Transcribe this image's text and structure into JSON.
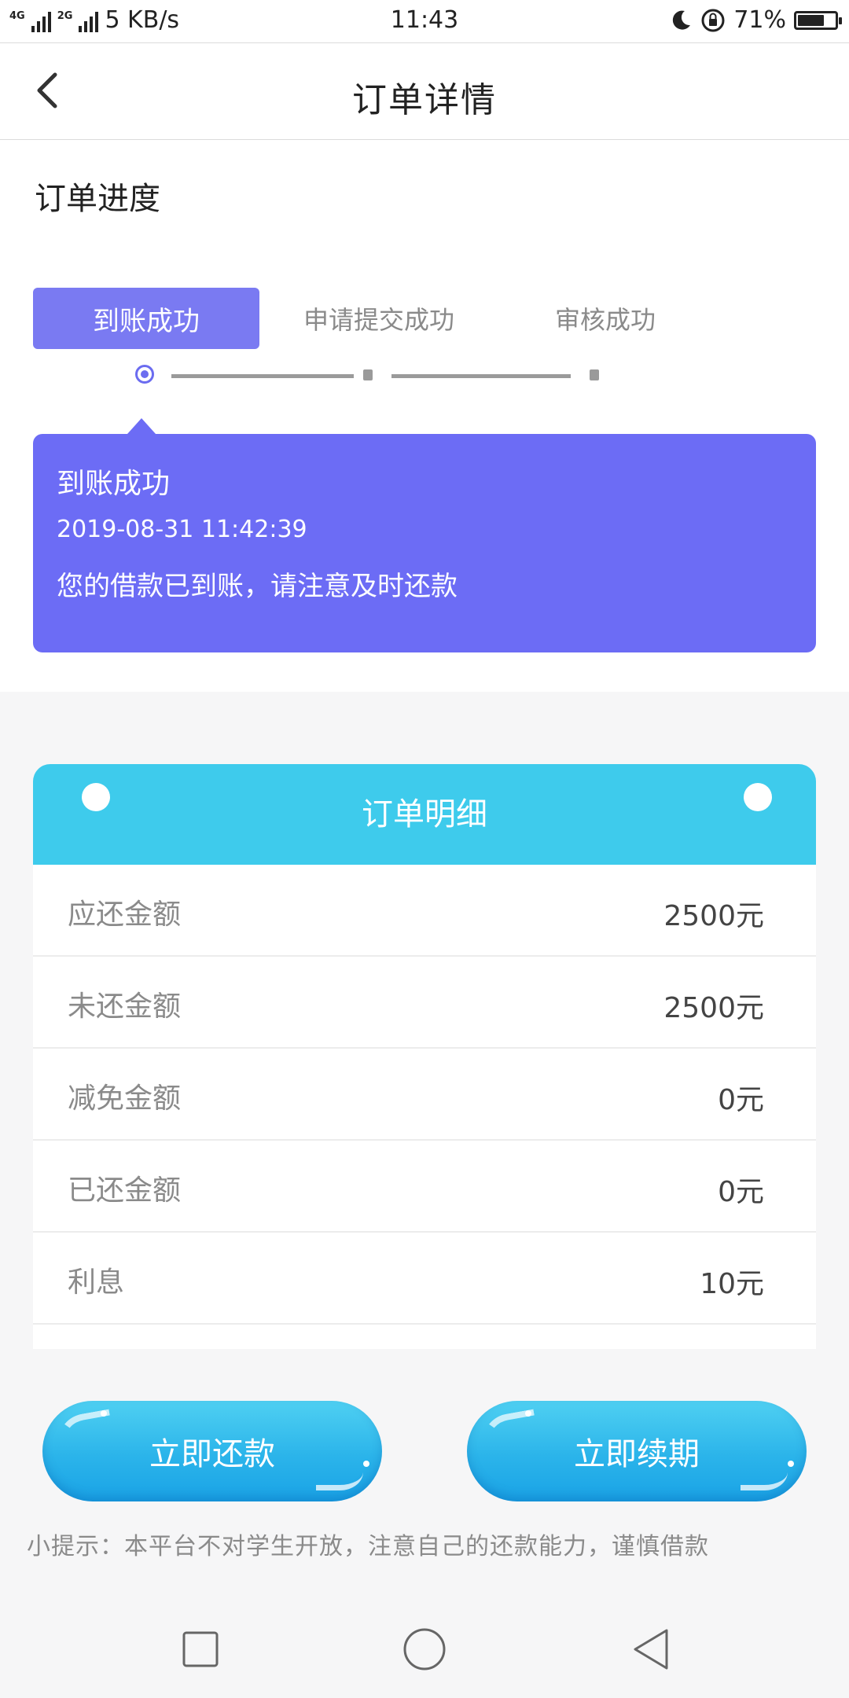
{
  "status_bar": {
    "network_1": "4G",
    "network_2": "2G",
    "speed": "5 KB/s",
    "time": "11:43",
    "battery": "71%",
    "battery_level": 0.71
  },
  "nav": {
    "title": "订单详情"
  },
  "progress": {
    "section_title": "订单进度",
    "steps": [
      "到账成功",
      "申请提交成功",
      "审核成功"
    ],
    "active_step_index": 0,
    "detail": {
      "title": "到账成功",
      "time": "2019-08-31 11:42:39",
      "message": "您的借款已到账，请注意及时还款"
    }
  },
  "order_detail": {
    "title": "订单明细",
    "rows": [
      {
        "label": "应还金额",
        "value": "2500元"
      },
      {
        "label": "未还金额",
        "value": "2500元"
      },
      {
        "label": "减免金额",
        "value": "0元"
      },
      {
        "label": "已还金额",
        "value": "0元"
      },
      {
        "label": "利息",
        "value": "10元"
      }
    ]
  },
  "actions": {
    "repay": "立即还款",
    "renew": "立即续期"
  },
  "tip": "小提示：本平台不对学生开放，注意自己的还款能力，谨慎借款",
  "colors": {
    "accent_purple": "#6c6cf5",
    "step_active": "#7a7af2",
    "detail_header": "#3ecbec",
    "button_blue": "#2bb4ea"
  },
  "icons": {
    "back": "chevron-left-icon",
    "moon": "moon-icon",
    "lock_rotation": "rotation-lock-icon",
    "nav_recent": "square-icon",
    "nav_home": "circle-icon",
    "nav_back": "triangle-back-icon"
  }
}
